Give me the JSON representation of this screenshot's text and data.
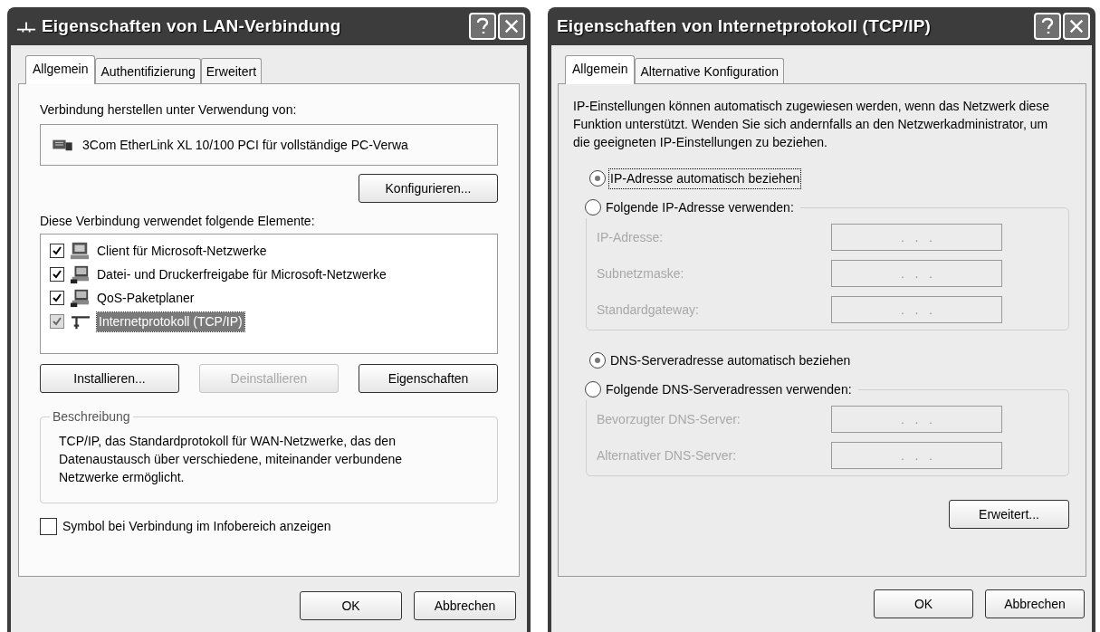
{
  "lan_dialog": {
    "title": "Eigenschaften von LAN-Verbindung",
    "tabs": [
      {
        "label": "Allgemein",
        "selected": true
      },
      {
        "label": "Authentifizierung",
        "selected": false
      },
      {
        "label": "Erweitert",
        "selected": false
      }
    ],
    "connect_label": "Verbindung herstellen unter Verwendung von:",
    "adapter": "3Com EtherLink XL 10/100 PCI für vollständige PC-Verwa",
    "configure_button": "Konfigurieren...",
    "elements_label": "Diese Verbindung verwendet folgende Elemente:",
    "elements": [
      {
        "kind": "client",
        "label": "Client für Microsoft-Netzwerke",
        "checked": true,
        "selected": false
      },
      {
        "kind": "service",
        "label": "Datei- und Druckerfreigabe für Microsoft-Netzwerke",
        "checked": true,
        "selected": false
      },
      {
        "kind": "service",
        "label": "QoS-Paketplaner",
        "checked": true,
        "selected": false
      },
      {
        "kind": "protocol",
        "label": "Internetprotokoll (TCP/IP)",
        "checked": true,
        "selected": true
      }
    ],
    "element_buttons": [
      {
        "label": "Installieren...",
        "disabled": false
      },
      {
        "label": "Deinstallieren",
        "disabled": true
      },
      {
        "label": "Eigenschaften",
        "disabled": false
      }
    ],
    "description": {
      "legend": "Beschreibung",
      "text": "TCP/IP, das Standardprotokoll für WAN-Netzwerke, das den Datenaustausch über verschiedene, miteinander verbundene Netzwerke ermöglicht."
    },
    "tray_checkbox": {
      "label": "Symbol bei Verbindung im Infobereich anzeigen",
      "checked": false
    },
    "footer_buttons": [
      "OK",
      "Abbrechen"
    ]
  },
  "tcpip_dialog": {
    "title": "Eigenschaften von Internetprotokoll (TCP/IP)",
    "tabs": [
      {
        "label": "Allgemein",
        "selected": true
      },
      {
        "label": "Alternative Konfiguration",
        "selected": false
      }
    ],
    "intro": "IP-Einstellungen können automatisch zugewiesen werden, wenn das Netzwerk diese Funktion unterstützt. Wenden Sie sich andernfalls an den Netzwerkadministrator, um die geeigneten IP-Einstellungen zu beziehen.",
    "ip_options": [
      {
        "label": "IP-Adresse automatisch beziehen",
        "selected": true,
        "focused": true
      },
      {
        "label": "Folgende IP-Adresse verwenden:",
        "selected": false,
        "focused": false
      }
    ],
    "ip_fields": [
      {
        "label": "IP-Adresse:",
        "value": ".   .   .",
        "disabled": true
      },
      {
        "label": "Subnetzmaske:",
        "value": ".   .   .",
        "disabled": true
      },
      {
        "label": "Standardgateway:",
        "value": ".   .   .",
        "disabled": true
      }
    ],
    "dns_options": [
      {
        "label": "DNS-Serveradresse automatisch beziehen",
        "selected": true,
        "focused": false
      },
      {
        "label": "Folgende DNS-Serveradressen verwenden:",
        "selected": false,
        "focused": false
      }
    ],
    "dns_fields": [
      {
        "label": "Bevorzugter DNS-Server:",
        "value": ".   .   .",
        "disabled": true
      },
      {
        "label": "Alternativer DNS-Server:",
        "value": ".   .   .",
        "disabled": true
      }
    ],
    "advanced_button": "Erweitert...",
    "footer_buttons": [
      "OK",
      "Abbrechen"
    ]
  }
}
